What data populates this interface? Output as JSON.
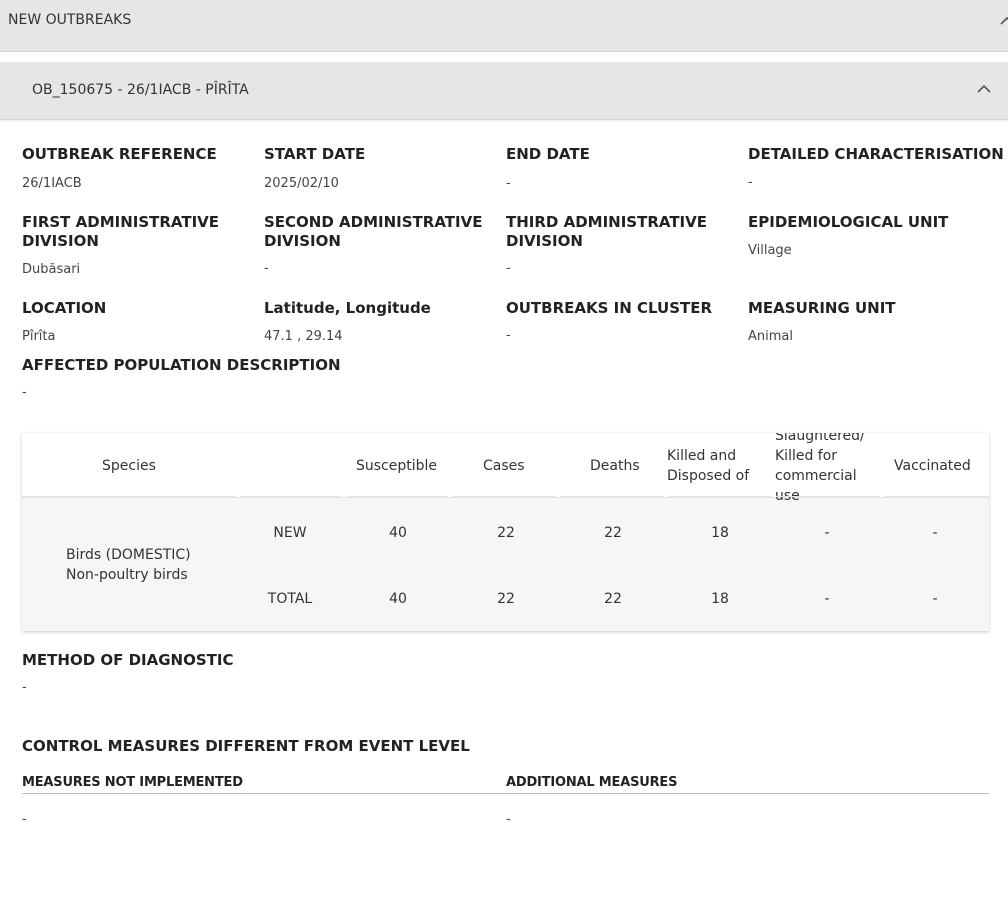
{
  "header": {
    "section_title": "NEW OUTBREAKS",
    "outbreak_title": "OB_150675 - 26/1IACB - PÎRÎTA"
  },
  "fields": {
    "outbreak_reference": {
      "label": "OUTBREAK REFERENCE",
      "value": "26/1IACB"
    },
    "start_date": {
      "label": "START DATE",
      "value": "2025/02/10"
    },
    "end_date": {
      "label": "END DATE",
      "value": "-"
    },
    "detailed_characterisation": {
      "label": "DETAILED CHARACTERISATION",
      "value": "-"
    },
    "first_admin_division": {
      "label_line1": "FIRST ADMINISTRATIVE",
      "label_line2": "DIVISION",
      "value": "Dubăsari"
    },
    "second_admin_division": {
      "label_line1": "SECOND ADMINISTRATIVE",
      "label_line2": "DIVISION",
      "value": "-"
    },
    "third_admin_division": {
      "label_line1": "THIRD ADMINISTRATIVE",
      "label_line2": "DIVISION",
      "value": "-"
    },
    "epidemiological_unit": {
      "label": "EPIDEMIOLOGICAL UNIT",
      "value": "Village"
    },
    "location": {
      "label": "LOCATION",
      "value": "Pîrîta"
    },
    "lat_long": {
      "label": "Latitude, Longitude",
      "value": "47.1 , 29.14"
    },
    "outbreaks_in_cluster": {
      "label": "OUTBREAKS IN CLUSTER",
      "value": "-"
    },
    "measuring_unit": {
      "label": "MEASURING UNIT",
      "value": "Animal"
    },
    "affected_population": {
      "label": "AFFECTED POPULATION DESCRIPTION",
      "value": "-"
    }
  },
  "table": {
    "headers": {
      "species": "Species",
      "susceptible": "Susceptible",
      "cases": "Cases",
      "deaths": "Deaths",
      "killed_line1": "Killed and",
      "killed_line2": "Disposed of",
      "slaughtered_line1": "Slaughtered/",
      "slaughtered_line2": "Killed for",
      "slaughtered_line3": "commercial",
      "slaughtered_line4": "use",
      "vaccinated": "Vaccinated"
    },
    "species_line1": "Birds (DOMESTIC)",
    "species_line2": "Non-poultry birds",
    "rows": [
      {
        "type": "NEW",
        "susceptible": "40",
        "cases": "22",
        "deaths": "22",
        "killed": "18",
        "slaughtered": "-",
        "vaccinated": "-"
      },
      {
        "type": "TOTAL",
        "susceptible": "40",
        "cases": "22",
        "deaths": "22",
        "killed": "18",
        "slaughtered": "-",
        "vaccinated": "-"
      }
    ]
  },
  "diagnostic": {
    "label": "METHOD OF DIAGNOSTIC",
    "value": "-"
  },
  "control_measures": {
    "title": "CONTROL MEASURES DIFFERENT FROM EVENT LEVEL",
    "not_implemented_label": "MEASURES NOT IMPLEMENTED",
    "not_implemented_value": "-",
    "additional_label": "ADDITIONAL MEASURES",
    "additional_value": "-"
  },
  "icons": {
    "collapse": "chevron-up-icon"
  }
}
